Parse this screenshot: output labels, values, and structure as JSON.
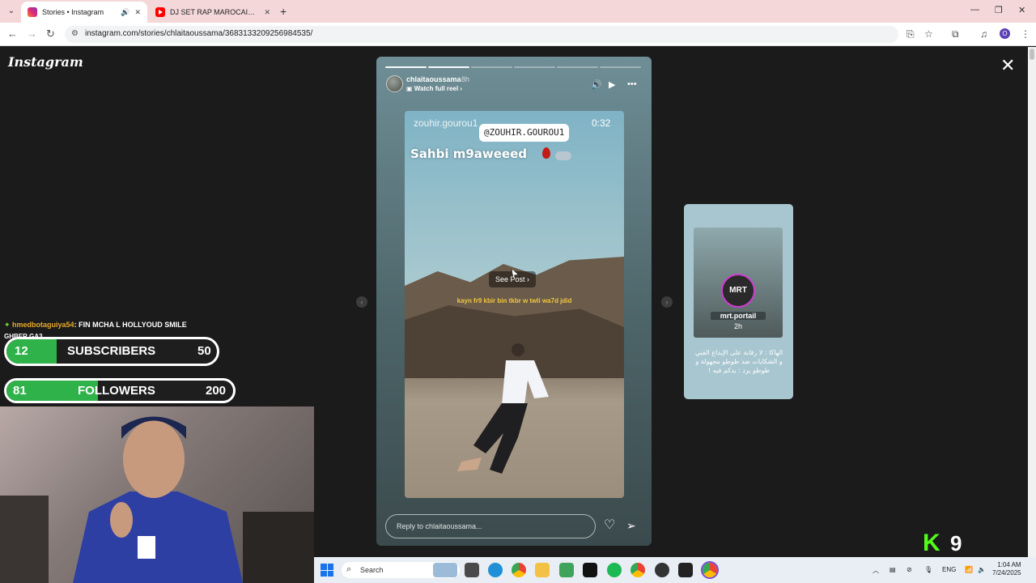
{
  "browser": {
    "tabs": [
      {
        "title": "Stories • Instagram",
        "active": true
      },
      {
        "title": "DJ SET RAP MAROCAIN : MES C",
        "active": false
      }
    ],
    "url": "instagram.com/stories/chlaitaoussama/3683133209256984535/",
    "profile_initial": "O"
  },
  "instagram": {
    "logo": "Instagram",
    "story": {
      "username": "chlaitaoussama",
      "time": "8h",
      "watch_full_reel": "Watch full reel",
      "reel_user": "zouhir.gourou1",
      "reel_time": "0:32",
      "mention": "@ZOUHIR.GOUROU1",
      "caption": "Sahbi m9aweeed",
      "see_post": "See Post",
      "subtitle": "kayn fr9 kbir bin tkbr w twli wa7d jdid",
      "reply_placeholder": "Reply to chlaitaoussama...",
      "progress_segments": 6,
      "progress_done": 2
    },
    "next_story": {
      "name": "mrt.portail",
      "time": "2h",
      "text": "الهاكا : لا رقابة على الإبداع الفني و الشكايات ضد طوطو مجهولة و طوطو يرد : يدكم فيه !"
    }
  },
  "overlay": {
    "chat_user": "hmedbotaguiya54",
    "chat_message": ": FIN MCHA L HOLLYOUD SMILE",
    "ghber": "GHBER GA3",
    "subscribers": {
      "current": "12",
      "label": "SUBSCRIBERS",
      "goal": "50",
      "progress": 0.24
    },
    "followers": {
      "current": "81",
      "label": "FOLLOWERS",
      "goal": "200",
      "progress": 0.405
    },
    "kick_logo": "K",
    "kick_count": "9"
  },
  "taskbar": {
    "search": "Search",
    "lang": "ENG",
    "time": "1:04 AM",
    "date": "7/24/2025"
  },
  "colors": {
    "tabbar": "#f4d8d9",
    "progress_fill": "#2fb24a",
    "kick": "#53fc18",
    "chat_user": "#e6a92a"
  }
}
